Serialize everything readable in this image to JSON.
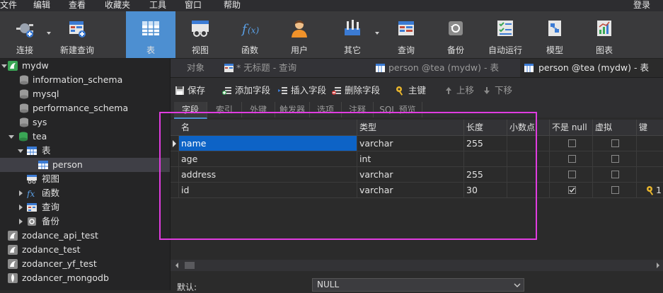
{
  "menu": {
    "items": [
      "文件",
      "编辑",
      "查看",
      "收藏夹",
      "工具",
      "窗口",
      "帮助"
    ],
    "login": "登录"
  },
  "toolbar": {
    "connect": "连接",
    "new_query": "新建查询",
    "table": "表",
    "view": "视图",
    "function": "函数",
    "user": "用户",
    "other": "其它",
    "query": "查询",
    "backup": "备份",
    "autorun": "自动运行",
    "model": "模型",
    "chart": "图表"
  },
  "sidebar": {
    "mydw": "mydw",
    "information_schema": "information_schema",
    "mysql": "mysql",
    "performance_schema": "performance_schema",
    "sys": "sys",
    "tea": "tea",
    "tables": "表",
    "person": "person",
    "views": "视图",
    "functions": "函数",
    "queries": "查询",
    "backups": "备份",
    "zodance_api_test": "zodance_api_test",
    "zodance_test": "zodance_test",
    "zodancer_yf_test": "zodancer_yf_test",
    "zodancer_mongodb": "zodancer_mongodb"
  },
  "tabs": {
    "objects": "对象",
    "untitled_query": "* 无标题 - 查询",
    "person_mydw": "person @tea (mydw) - 表",
    "person_mydw_active": "person @tea (mydw) - 表"
  },
  "subbar": {
    "save": "保存",
    "add_field": "添加字段",
    "insert_field": "插入字段",
    "delete_field": "删除字段",
    "primary_key": "主键",
    "move_up": "上移",
    "move_down": "下移"
  },
  "prop_tabs": [
    "字段",
    "索引",
    "外键",
    "触发器",
    "选项",
    "注释",
    "SQL 预览"
  ],
  "grid": {
    "headers": [
      "名",
      "类型",
      "长度",
      "小数点",
      "不是 null",
      "虚拟",
      "键"
    ],
    "rows": [
      {
        "name": "name",
        "type": "varchar",
        "length": "255",
        "decimals": "",
        "not_null": false,
        "virtual": false,
        "key": ""
      },
      {
        "name": "age",
        "type": "int",
        "length": "",
        "decimals": "",
        "not_null": false,
        "virtual": false,
        "key": ""
      },
      {
        "name": "address",
        "type": "varchar",
        "length": "255",
        "decimals": "",
        "not_null": false,
        "virtual": false,
        "key": ""
      },
      {
        "name": "id",
        "type": "varchar",
        "length": "30",
        "decimals": "",
        "not_null": true,
        "virtual": false,
        "key": "1"
      }
    ]
  },
  "bottom": {
    "default_label": "默认:",
    "default_value": "NULL"
  },
  "colors": {
    "accent": "#4d8fd1",
    "selection": "#0d63c6",
    "highlight_box": "#e03ce0"
  }
}
